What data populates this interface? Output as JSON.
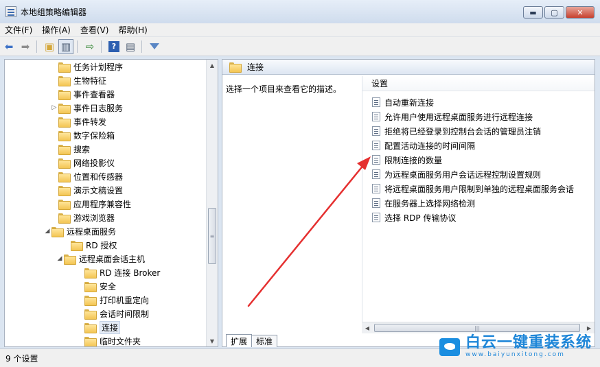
{
  "window": {
    "title": "本地组策略编辑器",
    "min": "▬",
    "max": "▢",
    "close": "✕"
  },
  "menu": [
    "文件(F)",
    "操作(A)",
    "查看(V)",
    "帮助(H)"
  ],
  "tree": {
    "items": [
      {
        "label": "任务计划程序"
      },
      {
        "label": "生物特征"
      },
      {
        "label": "事件查看器"
      },
      {
        "label": "事件日志服务",
        "expander": "▷"
      },
      {
        "label": "事件转发"
      },
      {
        "label": "数字保险箱"
      },
      {
        "label": "搜索"
      },
      {
        "label": "网络投影仪"
      },
      {
        "label": "位置和传感器"
      },
      {
        "label": "演示文稿设置"
      },
      {
        "label": "应用程序兼容性"
      },
      {
        "label": "游戏浏览器"
      },
      {
        "label": "远程桌面服务",
        "expander": "◢"
      },
      {
        "label": "RD 授权"
      },
      {
        "label": "远程桌面会话主机",
        "expander": "◢"
      },
      {
        "label": "RD 连接 Broker"
      },
      {
        "label": "安全"
      },
      {
        "label": "打印机重定向"
      },
      {
        "label": "会话时间限制"
      },
      {
        "label": "连接",
        "selected": true
      },
      {
        "label": "临时文件夹"
      }
    ]
  },
  "right": {
    "header": "连接",
    "description": "选择一个项目来查看它的描述。",
    "column": "设置",
    "settings": [
      "自动重新连接",
      "允许用户使用远程桌面服务进行远程连接",
      "拒绝将已经登录到控制台会话的管理员注销",
      "配置活动连接的时间间隔",
      "限制连接的数量",
      "为远程桌面服务用户会话远程控制设置规则",
      "将远程桌面服务用户限制到单独的远程桌面服务会话",
      "在服务器上选择网络检测",
      "选择 RDP 传输协议"
    ],
    "tabs": [
      "扩展",
      "标准"
    ]
  },
  "status": "9 个设置",
  "watermark": {
    "main": "白云一键重装系统",
    "sub": "www.baiyunxitong.com"
  },
  "colors": {
    "annotation_arrow": "#e53030",
    "accent": "#1e86d8"
  }
}
